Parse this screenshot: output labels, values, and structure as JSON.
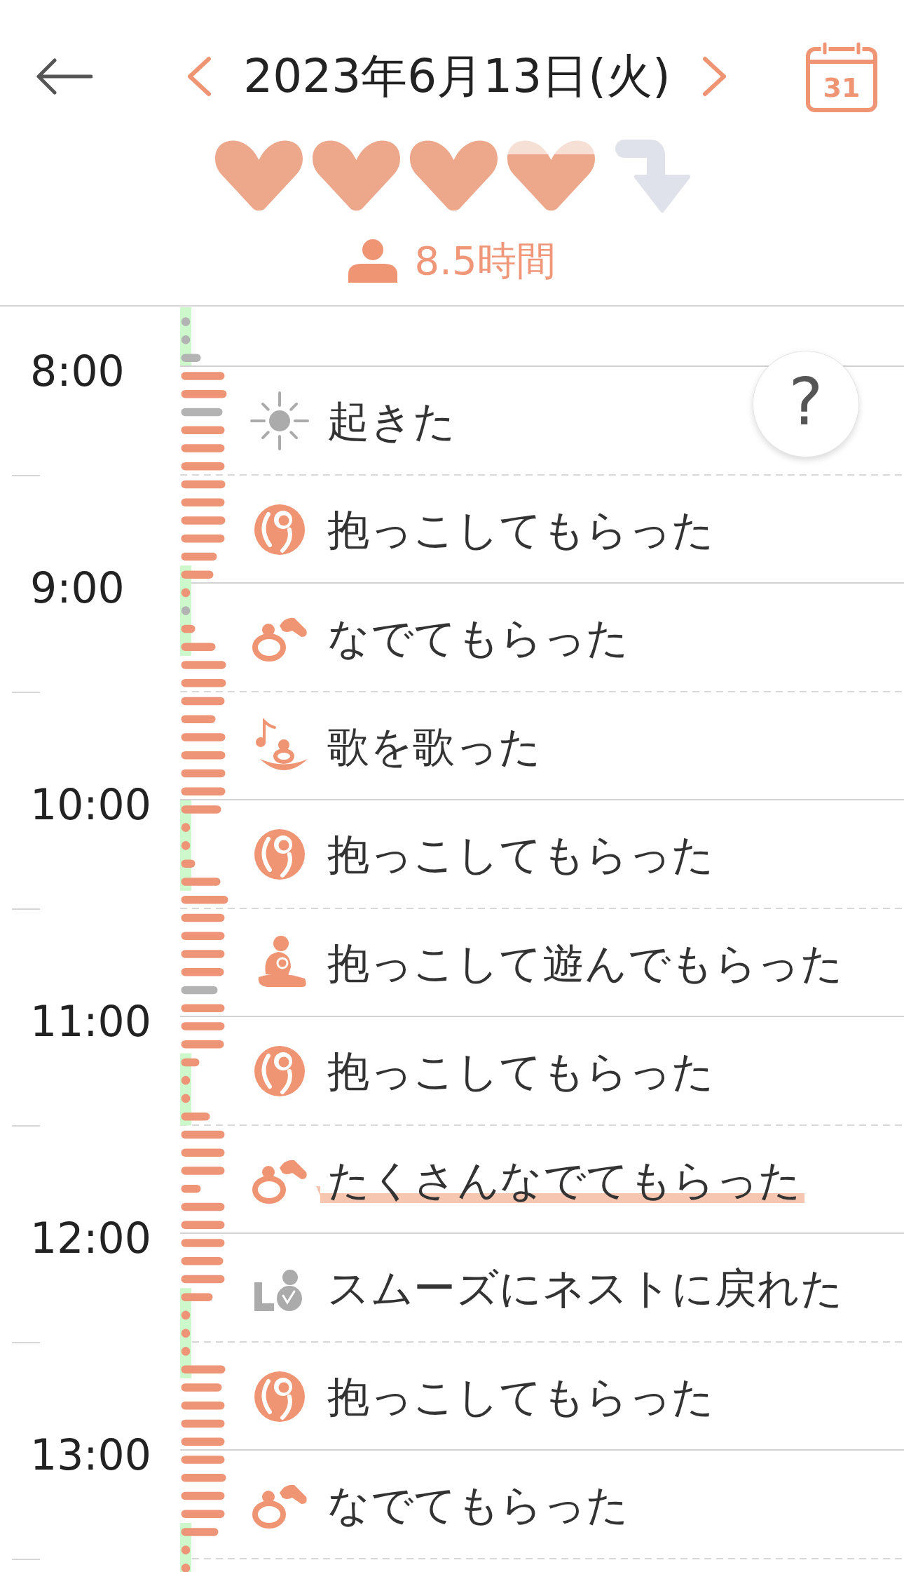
{
  "header": {
    "date": "2023年6月13日(火)",
    "calendar_day": "31"
  },
  "summary": {
    "hearts": {
      "stars": 3.8
    },
    "sleep_duration": "8.5時間"
  },
  "timeline": {
    "hours": [
      "8:00",
      "9:00",
      "10:00",
      "11:00",
      "12:00",
      "13:00"
    ],
    "events": [
      {
        "kind": "wake",
        "label": "起きた",
        "highlighted": false
      },
      {
        "kind": "hug",
        "label": "抱っこしてもらった",
        "highlighted": false
      },
      {
        "kind": "pet",
        "label": "なでてもらった",
        "highlighted": false
      },
      {
        "kind": "song",
        "label": "歌を歌った",
        "highlighted": false
      },
      {
        "kind": "hug",
        "label": "抱っこしてもらった",
        "highlighted": false
      },
      {
        "kind": "hug_play",
        "label": "抱っこして遊んでもらった",
        "highlighted": false
      },
      {
        "kind": "hug",
        "label": "抱っこしてもらった",
        "highlighted": false
      },
      {
        "kind": "pet",
        "label": "たくさんなでてもらった",
        "highlighted": true
      },
      {
        "kind": "nest",
        "label": "スムーズにネストに戻れた",
        "highlighted": false
      },
      {
        "kind": "hug",
        "label": "抱っこしてもらった",
        "highlighted": false
      },
      {
        "kind": "pet",
        "label": "なでてもらった",
        "highlighted": false
      }
    ]
  },
  "help_button": {
    "label": "?"
  }
}
